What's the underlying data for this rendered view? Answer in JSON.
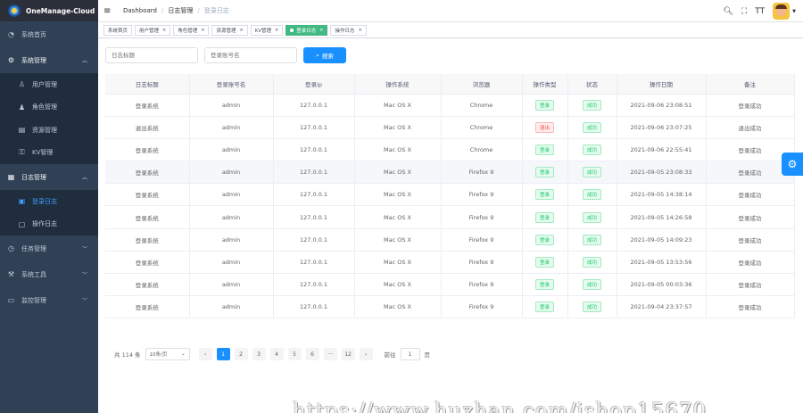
{
  "app": {
    "title": "OneManage-Cloud"
  },
  "sidebar": {
    "items": [
      {
        "label": "系统首页",
        "icon": "dashboard-icon"
      },
      {
        "label": "系统管理",
        "icon": "gear-icon",
        "expanded": true
      },
      {
        "label": "用户管理",
        "icon": "user-icon",
        "sub": true
      },
      {
        "label": "角色管理",
        "icon": "peoples-icon",
        "sub": true
      },
      {
        "label": "资源管理",
        "icon": "tree-icon",
        "sub": true
      },
      {
        "label": "KV管理",
        "icon": "key-icon",
        "sub": true
      },
      {
        "label": "日志管理",
        "icon": "log-icon",
        "expanded": true
      },
      {
        "label": "登录日志",
        "icon": "login-log-icon",
        "sub": true,
        "active": true
      },
      {
        "label": "操作日志",
        "icon": "form-icon",
        "sub": true
      },
      {
        "label": "任务管理",
        "icon": "job-icon"
      },
      {
        "label": "系统工具",
        "icon": "tool-icon"
      },
      {
        "label": "监控管理",
        "icon": "monitor-icon"
      }
    ]
  },
  "navbar": {
    "breadcrumb": [
      "Dashboard",
      "日志管理",
      "登录日志"
    ]
  },
  "tags": [
    {
      "label": "系统首页",
      "closable": false
    },
    {
      "label": "用户管理",
      "closable": true
    },
    {
      "label": "角色管理",
      "closable": true
    },
    {
      "label": "资源管理",
      "closable": true
    },
    {
      "label": "KV管理",
      "closable": true
    },
    {
      "label": "登录日志",
      "closable": true,
      "active": true
    },
    {
      "label": "操作日志",
      "closable": true
    }
  ],
  "search": {
    "title_placeholder": "日志标题",
    "account_placeholder": "登录账号名",
    "button_label": "搜索"
  },
  "table": {
    "columns": [
      "日志标题",
      "登录账号名",
      "登录ip",
      "操作系统",
      "浏览器",
      "操作类型",
      "状态",
      "操作日期",
      "备注"
    ],
    "rows": [
      {
        "title": "登录系统",
        "account": "admin",
        "ip": "127.0.0.1",
        "os": "Mac OS X",
        "browser": "Chrome",
        "op_type": "登录",
        "op_kind": "ok",
        "status": "成功",
        "date": "2021-09-06 23:08:51",
        "remark": "登录成功"
      },
      {
        "title": "退出系统",
        "account": "admin",
        "ip": "127.0.0.1",
        "os": "Mac OS X",
        "browser": "Chrome",
        "op_type": "退出",
        "op_kind": "bad",
        "status": "成功",
        "date": "2021-09-06 23:07:25",
        "remark": "退出成功"
      },
      {
        "title": "登录系统",
        "account": "admin",
        "ip": "127.0.0.1",
        "os": "Mac OS X",
        "browser": "Chrome",
        "op_type": "登录",
        "op_kind": "ok",
        "status": "成功",
        "date": "2021-09-06 22:55:41",
        "remark": "登录成功"
      },
      {
        "title": "登录系统",
        "account": "admin",
        "ip": "127.0.0.1",
        "os": "Mac OS X",
        "browser": "Firefox 9",
        "op_type": "登录",
        "op_kind": "ok",
        "status": "成功",
        "date": "2021-09-05 23:08:33",
        "remark": "登录成功",
        "highlight": true
      },
      {
        "title": "登录系统",
        "account": "admin",
        "ip": "127.0.0.1",
        "os": "Mac OS X",
        "browser": "Firefox 9",
        "op_type": "登录",
        "op_kind": "ok",
        "status": "成功",
        "date": "2021-09-05 14:38:14",
        "remark": "登录成功"
      },
      {
        "title": "登录系统",
        "account": "admin",
        "ip": "127.0.0.1",
        "os": "Mac OS X",
        "browser": "Firefox 9",
        "op_type": "登录",
        "op_kind": "ok",
        "status": "成功",
        "date": "2021-09-05 14:26:58",
        "remark": "登录成功"
      },
      {
        "title": "登录系统",
        "account": "admin",
        "ip": "127.0.0.1",
        "os": "Mac OS X",
        "browser": "Firefox 9",
        "op_type": "登录",
        "op_kind": "ok",
        "status": "成功",
        "date": "2021-09-05 14:09:23",
        "remark": "登录成功"
      },
      {
        "title": "登录系统",
        "account": "admin",
        "ip": "127.0.0.1",
        "os": "Mac OS X",
        "browser": "Firefox 9",
        "op_type": "登录",
        "op_kind": "ok",
        "status": "成功",
        "date": "2021-09-05 13:53:56",
        "remark": "登录成功"
      },
      {
        "title": "登录系统",
        "account": "admin",
        "ip": "127.0.0.1",
        "os": "Mac OS X",
        "browser": "Firefox 9",
        "op_type": "登录",
        "op_kind": "ok",
        "status": "成功",
        "date": "2021-09-05 00:03:36",
        "remark": "登录成功"
      },
      {
        "title": "登录系统",
        "account": "admin",
        "ip": "127.0.0.1",
        "os": "Mac OS X",
        "browser": "Firefox 9",
        "op_type": "登录",
        "op_kind": "ok",
        "status": "成功",
        "date": "2021-09-04 23:37:57",
        "remark": "登录成功"
      }
    ]
  },
  "pagination": {
    "total_label": "共 114 条",
    "page_size_label": "10条/页",
    "prev": "‹",
    "next": "›",
    "pages": [
      "1",
      "2",
      "3",
      "4",
      "5",
      "6",
      "···",
      "12"
    ],
    "current": "1",
    "goto_label": "前往",
    "goto_value": "1",
    "page_unit": "页"
  },
  "watermark": "https://www.huzhan.com/ishop15670",
  "colors": {
    "primary": "#1890ff",
    "sidebar": "#304156",
    "tag_active": "#42b983",
    "success": "#13ce66",
    "danger": "#ff4949"
  }
}
